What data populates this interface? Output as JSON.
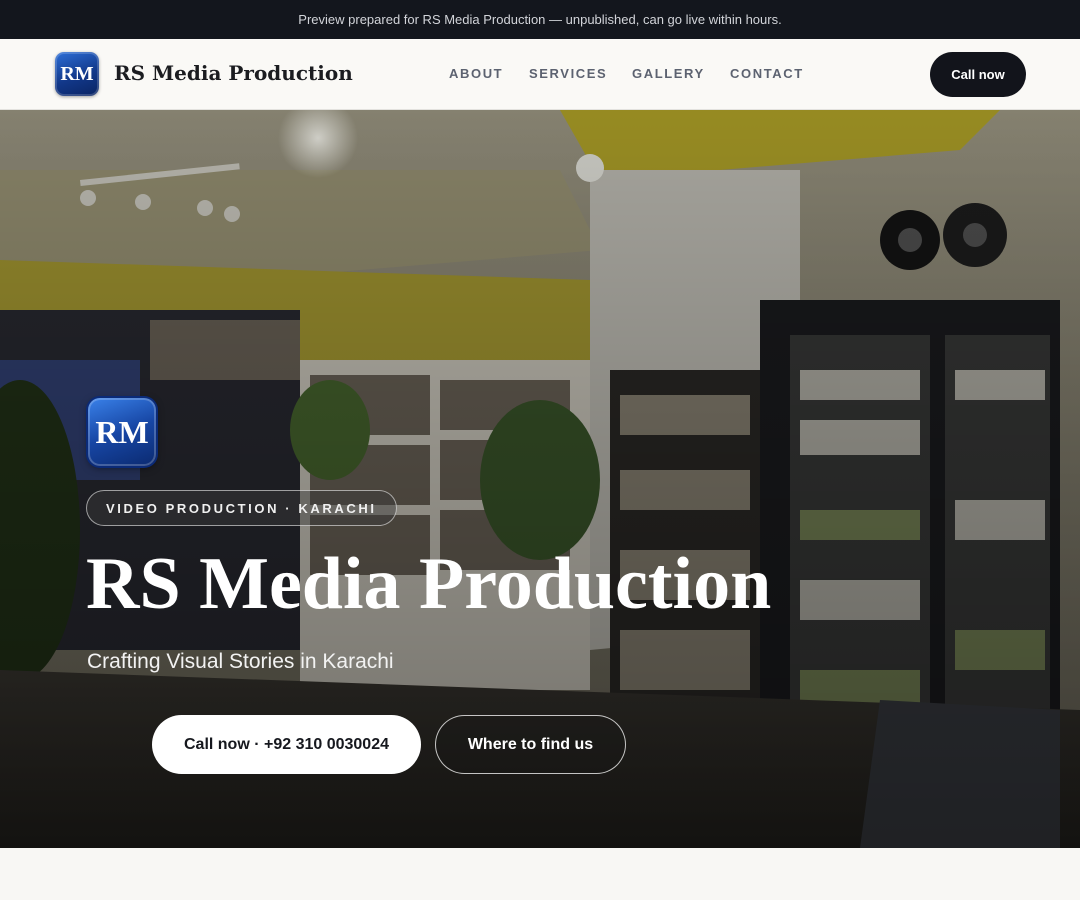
{
  "banner": {
    "text": "Preview prepared for RS Media Production — unpublished, can go live within hours."
  },
  "header": {
    "logo_text": "RM",
    "brand_name": "RS Media Production",
    "nav": {
      "about": "ABOUT",
      "services": "SERVICES",
      "gallery": "GALLERY",
      "contact": "CONTACT"
    },
    "cta_label": "Call now"
  },
  "hero": {
    "logo_text": "RM",
    "tag": "VIDEO PRODUCTION · KARACHI",
    "title": "RS Media Production",
    "subtitle": "Crafting Visual Stories in Karachi",
    "primary_button": "Call now · +92 310 0030024",
    "secondary_button": "Where to find us",
    "background_image": "record-store-interior-photo"
  },
  "colors": {
    "banner_bg": "#13161d",
    "dark_button": "#12141b",
    "logo_blue": "#1746a4",
    "page_bg": "#f8f7f4"
  }
}
